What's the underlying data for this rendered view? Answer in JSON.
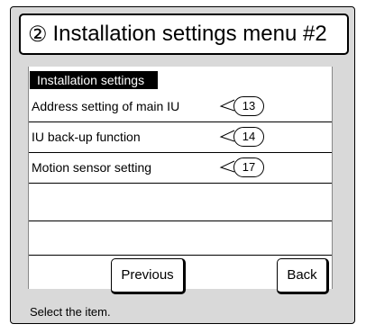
{
  "header": {
    "number_glyph": "②",
    "title": "Installation settings menu #2"
  },
  "section": {
    "label": "Installation settings"
  },
  "menu_items": [
    {
      "label": "Address setting of main IU",
      "ref": "13"
    },
    {
      "label": "IU back-up function",
      "ref": "14"
    },
    {
      "label": "Motion sensor setting",
      "ref": "17"
    },
    {
      "label": "",
      "ref": ""
    },
    {
      "label": "",
      "ref": ""
    }
  ],
  "buttons": {
    "previous": "Previous",
    "back": "Back"
  },
  "status_text": "Select the item."
}
